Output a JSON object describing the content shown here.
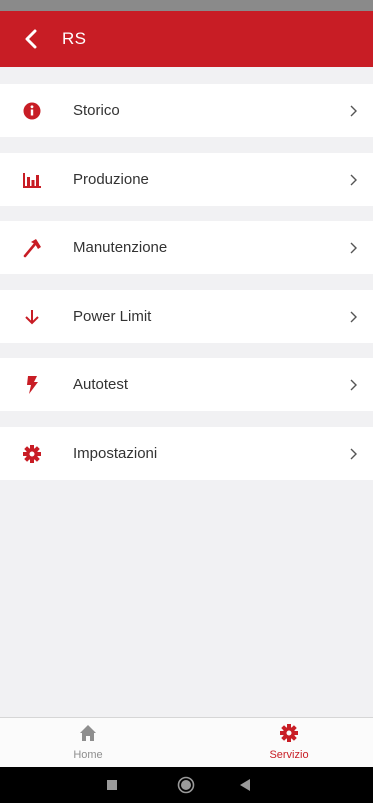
{
  "header": {
    "title": "RS"
  },
  "menu": {
    "items": [
      {
        "label": "Storico",
        "icon": "info-circle-icon"
      },
      {
        "label": "Produzione",
        "icon": "bar-chart-icon"
      },
      {
        "label": "Manutenzione",
        "icon": "hammer-icon"
      },
      {
        "label": "Power Limit",
        "icon": "arrow-down-icon"
      },
      {
        "label": "Autotest",
        "icon": "lightning-icon"
      },
      {
        "label": "Impostazioni",
        "icon": "gear-icon"
      }
    ]
  },
  "bottom_nav": {
    "home_label": "Home",
    "service_label": "Servizio",
    "active": "Servizio"
  },
  "colors": {
    "accent": "#c81d25",
    "header_bg": "#c81d25",
    "inactive_nav": "#8e8e8e"
  }
}
